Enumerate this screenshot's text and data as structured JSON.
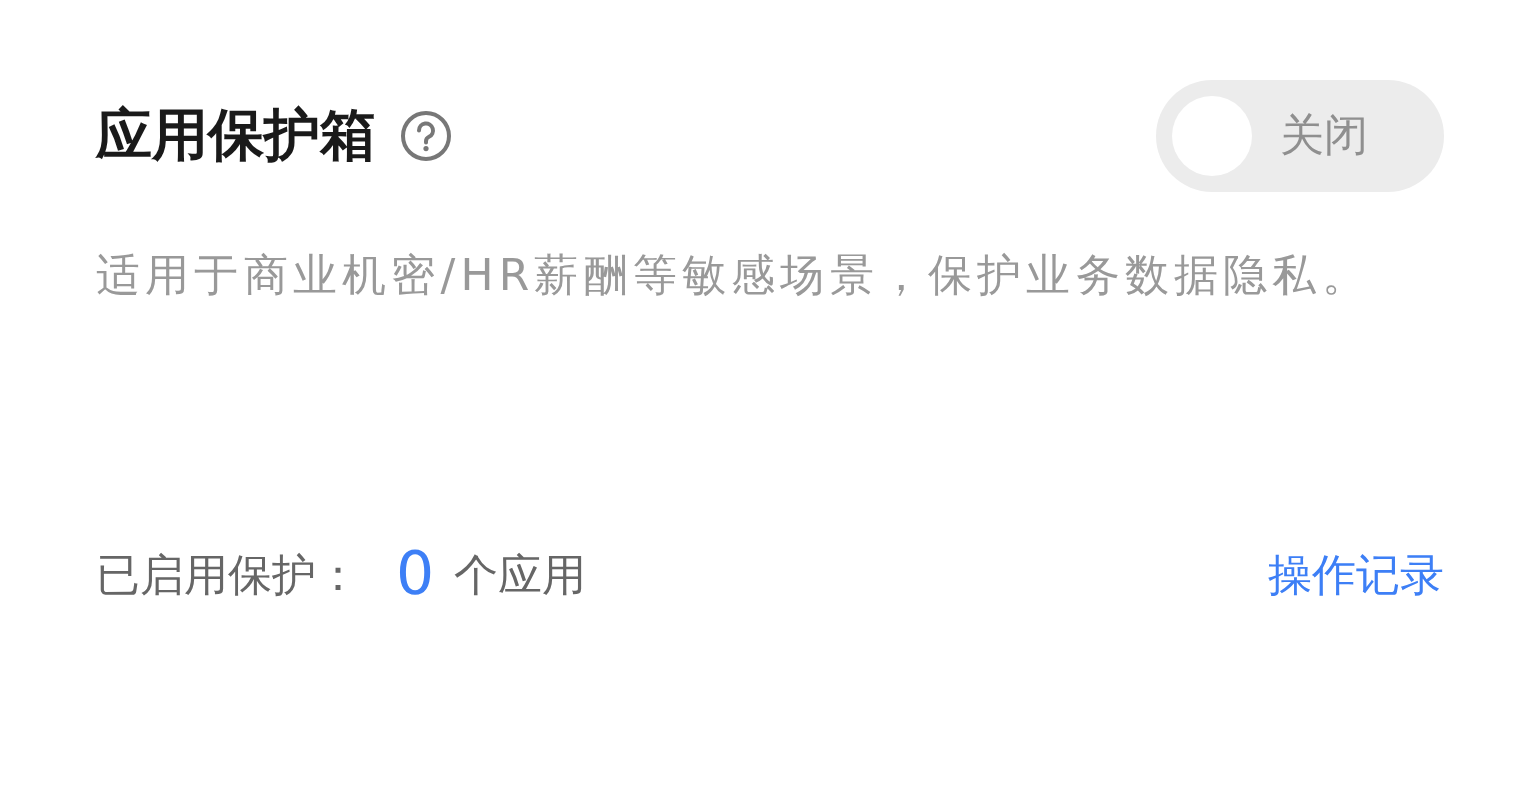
{
  "header": {
    "title": "应用保护箱"
  },
  "toggle": {
    "on": false,
    "label": "关闭"
  },
  "description": "适用于商业机密/HR薪酬等敏感场景，保护业务数据隐私。",
  "footer": {
    "prefix": "已启用保护：",
    "count": "0",
    "suffix": "个应用",
    "link": "操作记录"
  }
}
